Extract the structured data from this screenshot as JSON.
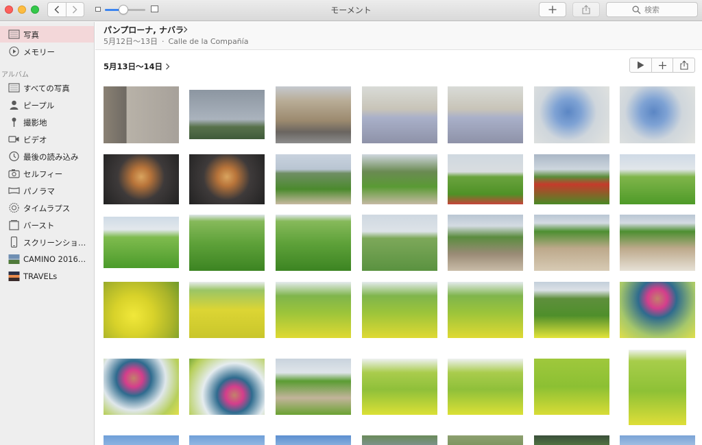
{
  "window": {
    "title": "モーメント"
  },
  "toolbar": {
    "search_placeholder": "検索",
    "zoom_level": 0.45
  },
  "sidebar": {
    "top_items": [
      {
        "label": "写真",
        "icon": "photos-icon",
        "active": true
      },
      {
        "label": "メモリー",
        "icon": "memories-icon",
        "active": false
      }
    ],
    "album_header": "アルバム",
    "albums": [
      {
        "label": "すべての写真",
        "icon": "all-photos-icon"
      },
      {
        "label": "ピープル",
        "icon": "people-icon"
      },
      {
        "label": "撮影地",
        "icon": "places-icon"
      },
      {
        "label": "ビデオ",
        "icon": "videos-icon"
      },
      {
        "label": "最後の読み込み",
        "icon": "last-import-icon"
      },
      {
        "label": "セルフィー",
        "icon": "selfies-icon"
      },
      {
        "label": "パノラマ",
        "icon": "panoramas-icon"
      },
      {
        "label": "タイムラプス",
        "icon": "timelapse-icon"
      },
      {
        "label": "バースト",
        "icon": "bursts-icon"
      },
      {
        "label": "スクリーンショ…",
        "icon": "screenshots-icon"
      },
      {
        "label": "CAMINO 2016…",
        "icon": "album-thumbnail-icon"
      },
      {
        "label": "TRAVELs",
        "icon": "album-thumbnail-icon"
      }
    ]
  },
  "moment": {
    "location": "パンプローナ, ナバラ",
    "dates": "5月12日〜13日",
    "place": "Calle de la Compañía",
    "separator": "·",
    "section_date": "5月13日〜14日"
  },
  "colors": {
    "accent": "#3b84f0",
    "active_row": "#f3d7d9"
  }
}
